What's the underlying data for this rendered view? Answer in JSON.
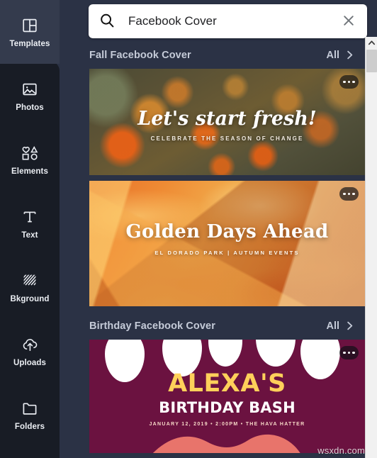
{
  "sidebar": {
    "items": [
      {
        "label": "Templates",
        "icon": "templates-icon",
        "active": true
      },
      {
        "label": "Photos",
        "icon": "photo-icon",
        "active": false
      },
      {
        "label": "Elements",
        "icon": "elements-icon",
        "active": false
      },
      {
        "label": "Text",
        "icon": "text-icon",
        "active": false
      },
      {
        "label": "Bkground",
        "icon": "background-icon",
        "active": false
      },
      {
        "label": "Uploads",
        "icon": "upload-cloud-icon",
        "active": false
      },
      {
        "label": "Folders",
        "icon": "folder-icon",
        "active": false
      }
    ]
  },
  "search": {
    "value": "Facebook Cover",
    "placeholder": "Search templates",
    "search_icon": "search-icon",
    "clear_icon": "close-icon"
  },
  "sections": [
    {
      "title": "Fall Facebook Cover",
      "all_label": "All",
      "all_icon": "chevron-right-icon"
    },
    {
      "title": "Birthday Facebook Cover",
      "all_label": "All",
      "all_icon": "chevron-right-icon"
    }
  ],
  "cards": {
    "forest": {
      "title": "Let's start fresh!",
      "subtitle": "CELEBRATE THE SEASON OF CHANGE",
      "menu_icon": "more-options-icon"
    },
    "leaves": {
      "title": "Golden Days Ahead",
      "subtitle": "EL DORADO PARK | AUTUMN EVENTS",
      "menu_icon": "more-options-icon"
    },
    "birthday": {
      "title": "ALEXA'S",
      "subtitle": "BIRTHDAY BASH",
      "meta": "JANUARY 12, 2019  •  2:00PM  •  THE HAVA HATTER",
      "menu_icon": "more-options-icon"
    }
  },
  "scrollbar": {
    "up_icon": "chevron-up-icon"
  },
  "watermark": "wsxdn.com",
  "colors": {
    "rail_bg": "#2b3245",
    "rail_panel_bg": "#181c25",
    "rail_active_bg": "#343b4d",
    "main_bg": "#2b3245",
    "section_text": "#c5cbd8",
    "search_bg": "#ffffff",
    "birthday_bg": "#6b1240",
    "birthday_title": "#ffd05a",
    "birthday_wave": "#e8746b"
  }
}
